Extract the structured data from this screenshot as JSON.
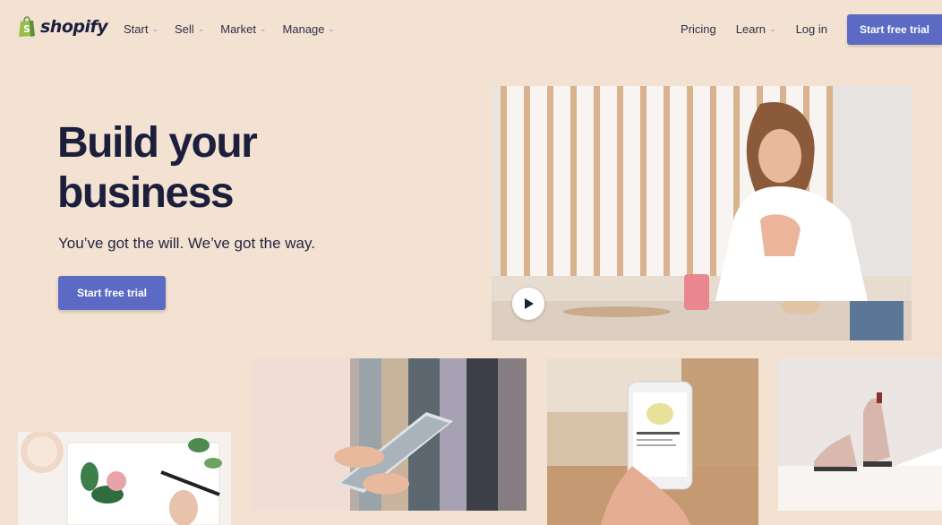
{
  "brand": {
    "name": "shopify",
    "logo_letter": "S",
    "accent": "#5c6ac4",
    "logo_green": "#95bf47"
  },
  "nav": {
    "menu": [
      {
        "label": "Start",
        "has_dropdown": true
      },
      {
        "label": "Sell",
        "has_dropdown": true
      },
      {
        "label": "Market",
        "has_dropdown": true
      },
      {
        "label": "Manage",
        "has_dropdown": true
      }
    ],
    "pricing": "Pricing",
    "learn": "Learn",
    "login": "Log in",
    "cta": "Start free trial"
  },
  "hero": {
    "title": "Build your business",
    "subtitle": "You’ve got the will. We’ve got the way.",
    "cta": "Start free trial"
  },
  "icons": {
    "dropdown": "chevron-down-icon",
    "play": "play-icon",
    "logo": "shopping-bag-icon"
  },
  "colors": {
    "background": "#f3e2d2",
    "heading": "#1b1f3b"
  }
}
